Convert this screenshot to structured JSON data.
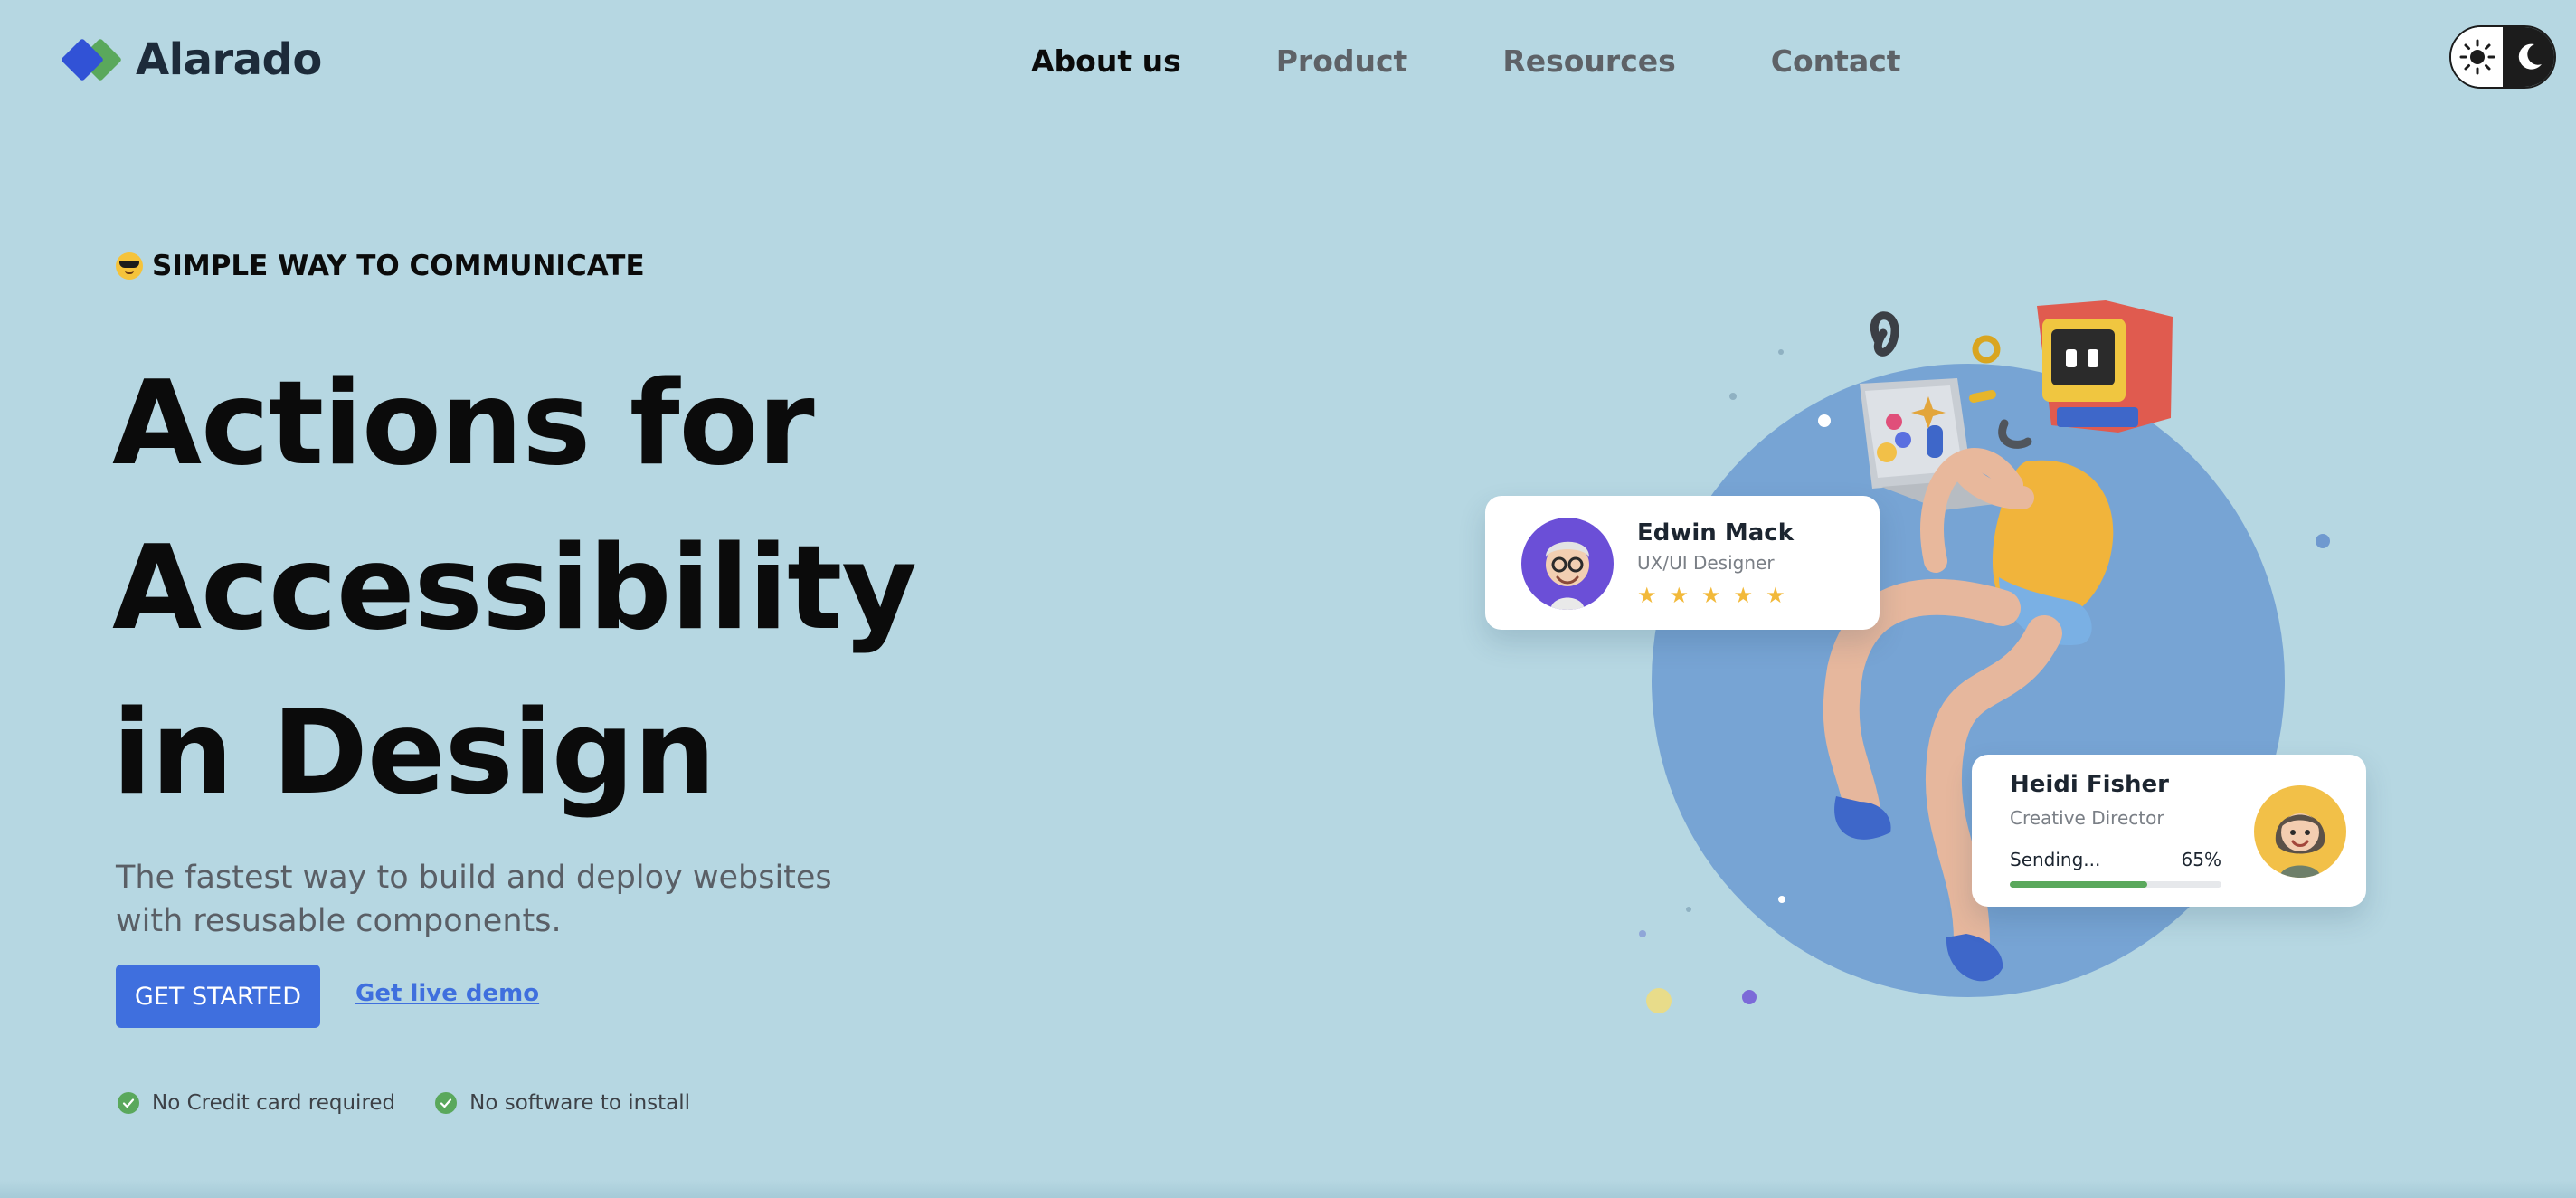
{
  "brand": {
    "name": "Alarado"
  },
  "nav": {
    "items": [
      {
        "label": "About us",
        "active": true
      },
      {
        "label": "Product",
        "active": false
      },
      {
        "label": "Resources",
        "active": false
      },
      {
        "label": "Contact",
        "active": false
      }
    ]
  },
  "theme_toggle": {
    "light_icon": "sun-icon",
    "dark_icon": "moon-icon"
  },
  "hero": {
    "eyebrow_icon": "sunglasses-emoji-icon",
    "eyebrow": "SIMPLE WAY TO COMMUNICATE",
    "headline_lines": [
      "Actions for",
      "Accessibility",
      "in Design"
    ],
    "subtitle": "The fastest way to build and deploy websites with resusable components.",
    "cta_label": "GET STARTED",
    "demo_label": "Get live demo",
    "perks": [
      "No Credit card required",
      "No software to install"
    ]
  },
  "cards": {
    "edwin": {
      "name": "Edwin Mack",
      "role": "UX/UI Designer",
      "rating": 5,
      "stars": [
        "★",
        "★",
        "★",
        "★",
        "★"
      ]
    },
    "heidi": {
      "name": "Heidi Fisher",
      "role": "Creative Director",
      "status": "Sending...",
      "progress_label": "65%",
      "progress": 0.65
    }
  },
  "colors": {
    "background": "#b6d7e2",
    "accent": "#3f6fde",
    "brand_blue": "#3152d6",
    "brand_green": "#5aa85c",
    "circle": "#77a4d4",
    "star": "#f2b93a"
  }
}
